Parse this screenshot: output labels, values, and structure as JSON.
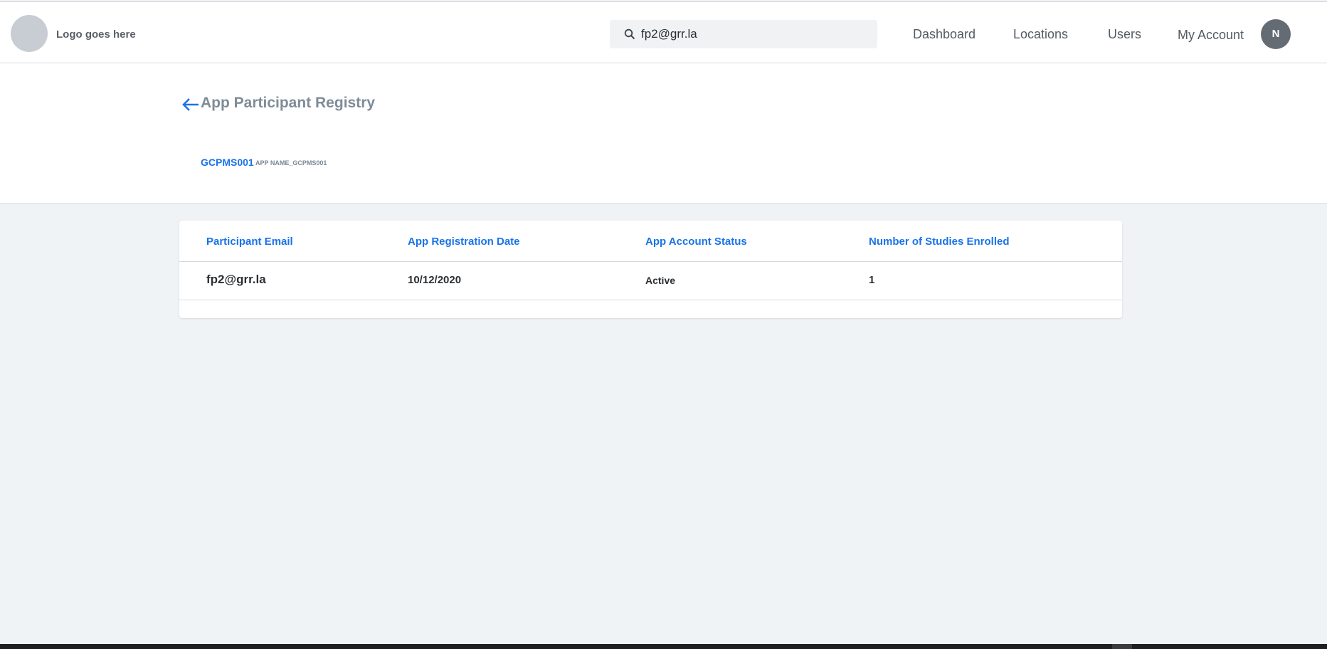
{
  "header": {
    "logo_text": "Logo goes here",
    "search": {
      "value": "fp2@grr.la",
      "icon": "search-icon"
    },
    "nav": [
      {
        "label": "Dashboard"
      },
      {
        "label": "Locations"
      },
      {
        "label": "Users"
      },
      {
        "label": "My Account"
      }
    ],
    "avatar_initial": "N"
  },
  "subheader": {
    "back_icon": "arrow-left-icon",
    "title": "App Participant Registry",
    "app_id": "GCPMS001",
    "app_name": "APP NAME_GCPMS001"
  },
  "table": {
    "columns": [
      "Participant Email",
      "App Registration Date",
      "App Account Status",
      "Number of Studies Enrolled"
    ],
    "rows": [
      {
        "email": "fp2@grr.la",
        "registration_date": "10/12/2020",
        "status": "Active",
        "studies_enrolled": "1"
      }
    ]
  },
  "colors": {
    "accent": "#1a73e8",
    "title_gray": "#7f8c98",
    "page_background": "#f0f3f6",
    "avatar": "#656b73"
  }
}
